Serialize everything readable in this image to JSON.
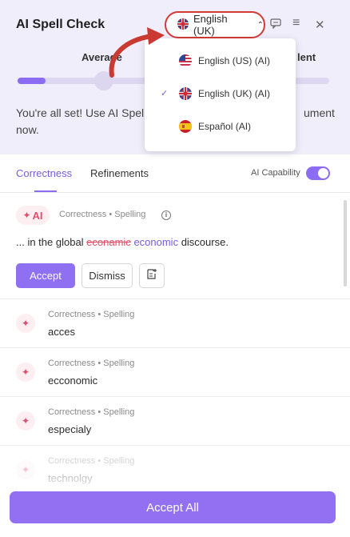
{
  "header": {
    "title": "AI Spell Check",
    "language": "English (UK)"
  },
  "level": {
    "left_label": "Average",
    "right_label": "lent",
    "progress": 0.09
  },
  "status_message": "You're all set! Use AI Spell Check to review the entire document now.",
  "status_message_visible": [
    "You're all set! Use AI Spell",
    "ument",
    "now."
  ],
  "tabs": [
    {
      "label": "Correctness",
      "active": true
    },
    {
      "label": "Refinements",
      "active": false
    }
  ],
  "ai_capability": {
    "label": "AI Capability",
    "enabled": true
  },
  "active_card": {
    "badge": "AI",
    "category": "Correctness • Spelling",
    "prefix": "... in the global ",
    "wrong": "econamic",
    "correct": "economic",
    "suffix": " discourse.",
    "accept_label": "Accept",
    "dismiss_label": "Dismiss"
  },
  "suggestions": [
    {
      "category": "Correctness • Spelling",
      "word": "acces"
    },
    {
      "category": "Correctness • Spelling",
      "word": "ecconomic"
    },
    {
      "category": "Correctness • Spelling",
      "word": "especialy"
    },
    {
      "category": "Correctness • Spelling",
      "word": "technolgy"
    }
  ],
  "accept_all_label": "Accept All",
  "language_menu": [
    {
      "label": "English (US) (AI)",
      "selected": false,
      "flag": "us-flag-icon"
    },
    {
      "label": "English (UK) (AI)",
      "selected": true,
      "flag": "uk-flag-icon"
    },
    {
      "label": "Español (AI)",
      "selected": false,
      "flag": "spain-flag-icon"
    }
  ],
  "colors": {
    "accent": "#8f6ff2",
    "highlight": "#d33a35",
    "error": "#e0506b",
    "top_bg": "#f1eefb"
  }
}
